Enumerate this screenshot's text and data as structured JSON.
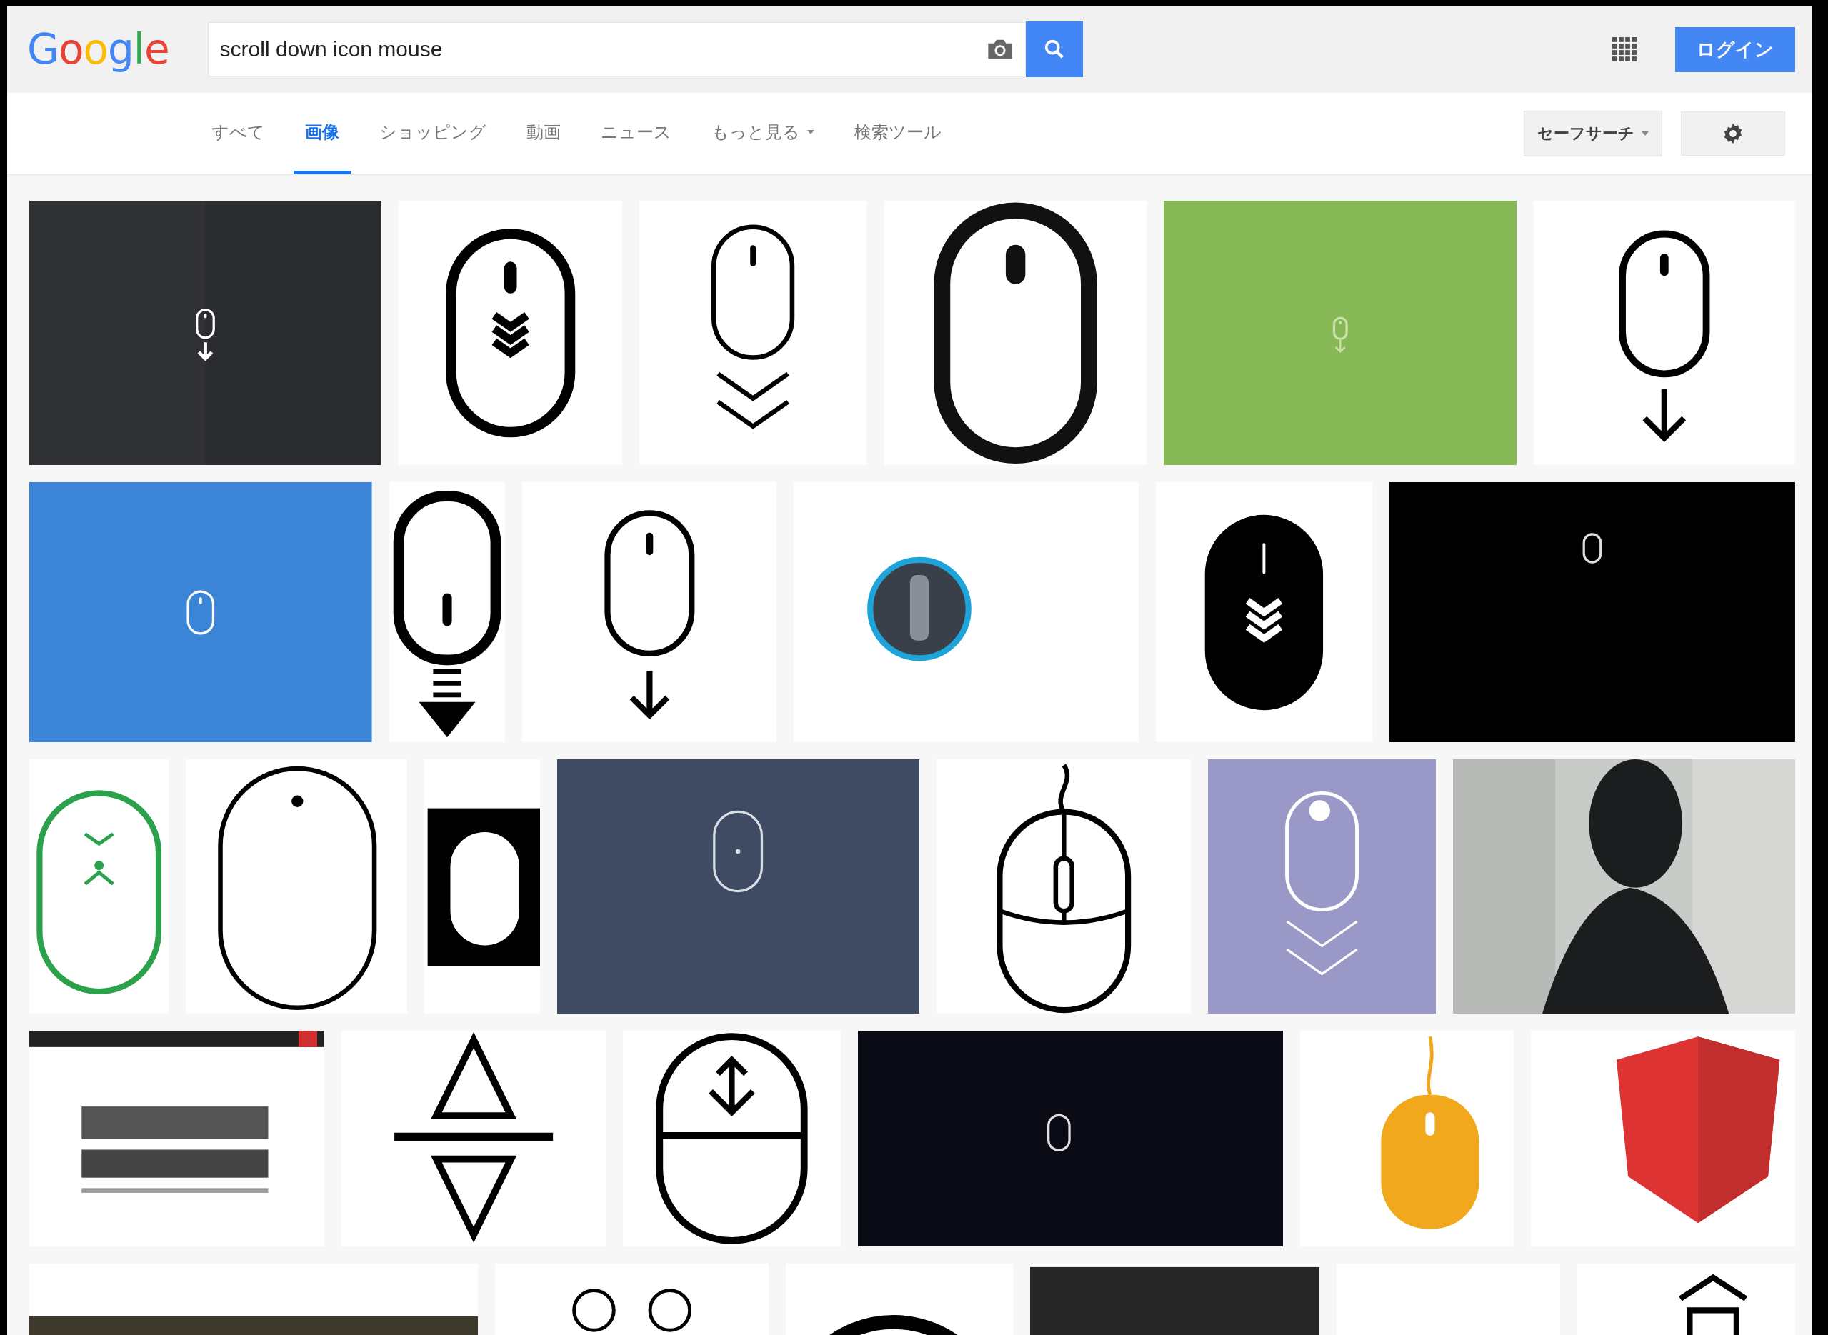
{
  "header": {
    "logo": "Google",
    "search": {
      "value": "scroll down icon mouse"
    },
    "login": "ログイン"
  },
  "tabs": [
    {
      "label": "すべて",
      "selected": false,
      "dropdown": false
    },
    {
      "label": "画像",
      "selected": true,
      "dropdown": false
    },
    {
      "label": "ショッピング",
      "selected": false,
      "dropdown": false
    },
    {
      "label": "動画",
      "selected": false,
      "dropdown": false
    },
    {
      "label": "ニュース",
      "selected": false,
      "dropdown": false
    },
    {
      "label": "もっと見る",
      "selected": false,
      "dropdown": true
    },
    {
      "label": "検索ツール",
      "selected": false,
      "dropdown": false
    }
  ],
  "safe_search": {
    "label": "セーフサーチ"
  }
}
